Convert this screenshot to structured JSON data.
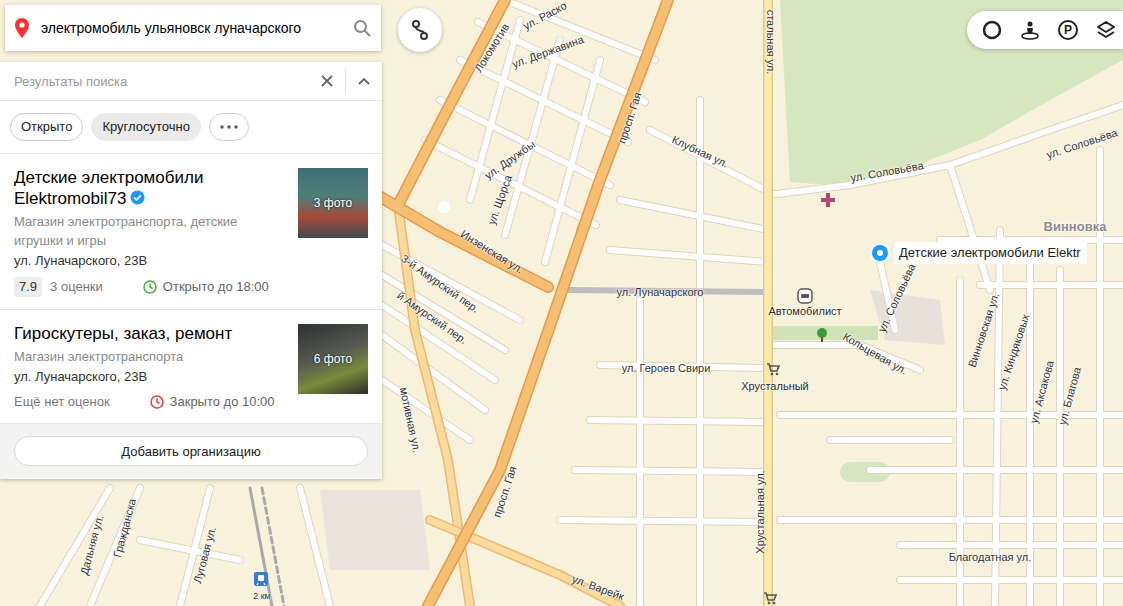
{
  "search": {
    "query": "электромобиль ульяновск луначарского"
  },
  "results_panel": {
    "title": "Результаты поиска"
  },
  "filters": [
    {
      "label": "Открыто",
      "selected": false,
      "kind": "outlined"
    },
    {
      "label": "Круглосуточно",
      "selected": false,
      "kind": "filled"
    }
  ],
  "results": [
    {
      "title": "Детские электромобили Elektromobil73",
      "verified": true,
      "category": "Магазин электротранспорта, детские игрушки и игры",
      "address": "ул. Луначарского, 23В",
      "rating": "7.9",
      "ratings_count": "3 оценки",
      "hours": "Открыто до 18:00",
      "open": true,
      "photos": "3 фото"
    },
    {
      "title": "Гироскутеры, заказ, ремонт",
      "verified": false,
      "category": "Магазин электротранспорта",
      "address": "ул. Луначарского, 23В",
      "rating": "",
      "ratings_count": "Ещё нет оценок",
      "hours": "Закрыто до 10:00",
      "open": false,
      "photos": "6 фото"
    }
  ],
  "add_button": "Добавить организацию",
  "map_controls": {
    "parking": "P"
  },
  "map": {
    "pin": {
      "label": "Детские электромобили Elektr"
    },
    "labels": [
      {
        "text": "ул. Раско",
        "kind": "street"
      },
      {
        "text": "ул. Державина",
        "kind": "street"
      },
      {
        "text": "Локомотив",
        "kind": "street"
      },
      {
        "text": "просп. Гая",
        "kind": "street"
      },
      {
        "text": "Клубная ул.",
        "kind": "street"
      },
      {
        "text": "стальная ул.",
        "kind": "street"
      },
      {
        "text": "ул. Соловьёва",
        "kind": "street"
      },
      {
        "text": "ул. Соловьёва",
        "kind": "street"
      },
      {
        "text": "Винновка",
        "kind": "district"
      },
      {
        "text": "ул. Дружбы",
        "kind": "street"
      },
      {
        "text": "ул. Щорса",
        "kind": "street"
      },
      {
        "text": "Инзенская ул.",
        "kind": "street"
      },
      {
        "text": "3-й Амурский пер.",
        "kind": "street"
      },
      {
        "text": "й Амурский пер.",
        "kind": "street"
      },
      {
        "text": "ул. Луначарского",
        "kind": "street"
      },
      {
        "text": "ул. Соловьёва",
        "kind": "street"
      },
      {
        "text": "Кольцевая ул.",
        "kind": "street"
      },
      {
        "text": "Винновская ул.",
        "kind": "street"
      },
      {
        "text": "ул. Киндяковых",
        "kind": "street"
      },
      {
        "text": "ул. Аксакова",
        "kind": "street"
      },
      {
        "text": "ул. Благова",
        "kind": "street"
      },
      {
        "text": "ул. Героев Свири",
        "kind": "street"
      },
      {
        "text": "мотивная ул.",
        "kind": "street"
      },
      {
        "text": "просп. Гая",
        "kind": "street"
      },
      {
        "text": "Хрустальная ул.",
        "kind": "street"
      },
      {
        "text": "Благодатная ул.",
        "kind": "street"
      },
      {
        "text": "ул. Варейк",
        "kind": "street"
      },
      {
        "text": "Дальняя ул.",
        "kind": "street"
      },
      {
        "text": "Гражданска",
        "kind": "street"
      },
      {
        "text": "Луговая ул.",
        "kind": "street"
      },
      {
        "text": "2 км",
        "kind": "station"
      },
      {
        "text": "Автомобилист",
        "kind": "poi"
      },
      {
        "text": "Хрустальный",
        "kind": "poi"
      }
    ]
  }
}
